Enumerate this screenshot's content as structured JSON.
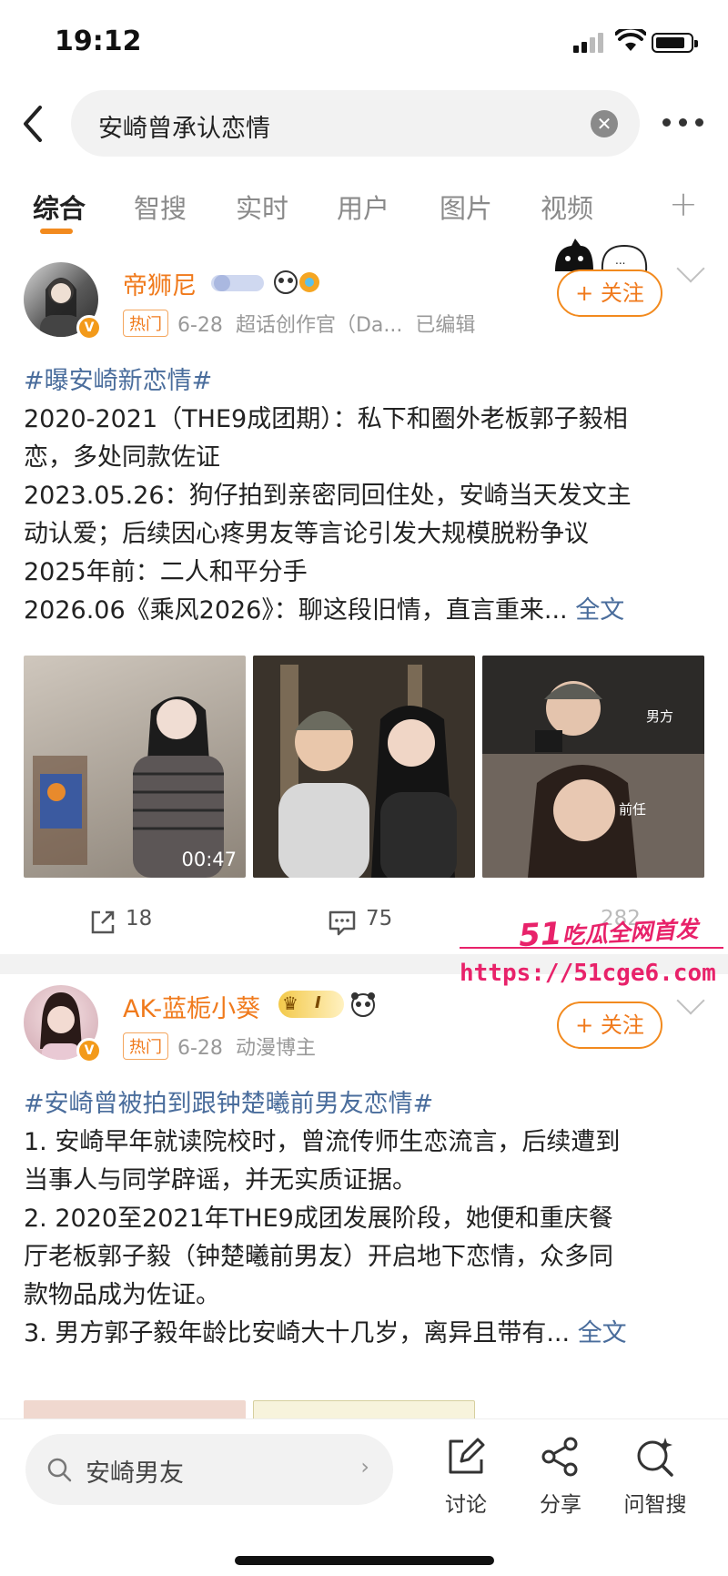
{
  "status": {
    "time": "19:12"
  },
  "search": {
    "query": "安崎曾承认恋情",
    "clear_glyph": "✕"
  },
  "tabs": [
    {
      "label": "综合",
      "active": true
    },
    {
      "label": "智搜"
    },
    {
      "label": "实时"
    },
    {
      "label": "用户"
    },
    {
      "label": "图片"
    },
    {
      "label": "视频"
    }
  ],
  "tab_plus": "+",
  "posts": [
    {
      "user": "帝狮尼",
      "hot": "热门",
      "date": "6-28",
      "source": "超话创作官（Da...",
      "edited": "已编辑",
      "follow": "+ 关注",
      "hashtag": "#曝安崎新恋情#",
      "lines": [
        "2020-2021（THE9成团期）：私下和圈外老板郭子毅相",
        "恋，多处同款佐证",
        "2023.05.26：狗仔拍到亲密同回住处，安崎当天发文主",
        "动认爱；后续因心疼男友等言论引发大规模脱粉争议",
        "2025年前：二人和平分手",
        "2026.06《乘风2026》：聊这段旧情，直言重来..."
      ],
      "full_text": "全文",
      "video_duration": "00:47",
      "image3_labels": [
        "男方",
        "前任"
      ],
      "repost_count": "18",
      "comment_count": "75",
      "like_count": "282"
    },
    {
      "user": "AK-蓝栀小葵",
      "level": "I",
      "hot": "热门",
      "date": "6-28",
      "source": "动漫博主",
      "follow": "+ 关注",
      "hashtag": "#安崎曾被拍到跟钟楚曦前男友恋情#",
      "lines": [
        "1. 安崎早年就读院校时，曾流传师生恋流言，后续遭到",
        "当事人与同学辟谣，并无实质证据。",
        "2. 2020至2021年THE9成团发展阶段，她便和重庆餐",
        "厅老板郭子毅（钟楚曦前男友）开启地下恋情，众多同",
        "款物品成为佐证。",
        "3. 男方郭子毅年龄比安崎大十几岁，离异且带有..."
      ],
      "full_text": "全文"
    }
  ],
  "watermark": {
    "line1_big": "51",
    "line1_small": "吃瓜全网首发",
    "line2": "https://51cge6.com"
  },
  "bottom": {
    "search_query": "安崎男友",
    "arrow": "›",
    "actions": [
      {
        "label": "讨论",
        "icon": "edit-icon"
      },
      {
        "label": "分享",
        "icon": "share-icon"
      },
      {
        "label": "问智搜",
        "icon": "ai-search-icon"
      }
    ]
  },
  "colors": {
    "accent": "#f28a1e",
    "link": "#4a6d9c",
    "watermark": "#e8226a"
  }
}
